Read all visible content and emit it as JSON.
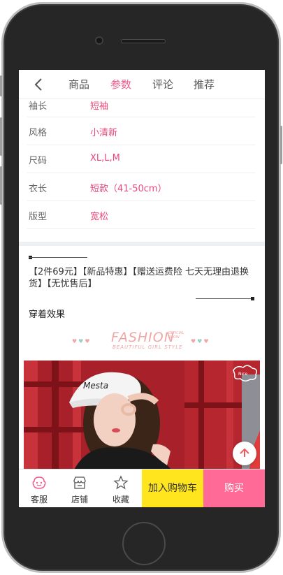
{
  "header": {
    "tabs": [
      {
        "label": "商品"
      },
      {
        "label": "参数"
      },
      {
        "label": "评论"
      },
      {
        "label": "推荐"
      }
    ],
    "active_tab": "参数"
  },
  "specs": [
    {
      "key": "袖长",
      "value": "短袖"
    },
    {
      "key": "风格",
      "value": "小清新"
    },
    {
      "key": "尺码",
      "value": "XL,L,M"
    },
    {
      "key": "衣长",
      "value": "短款（41-50cm）"
    },
    {
      "key": "版型",
      "value": "宽松"
    }
  ],
  "promo_text": "【2件69元】【新品特惠】【赠送运费险 七天无理由退换货】【无忧售后】",
  "wear_title": "穿着效果",
  "banner": {
    "title": "FASHION",
    "subtitle": "BEAUTIFUL GIRL STYLE",
    "small_text": "OFFICIAL SHOW"
  },
  "bottom_bar": {
    "service_label": "客服",
    "shop_label": "店铺",
    "favorite_label": "收藏",
    "cart_label": "加入购物车",
    "buy_label": "购买"
  },
  "colors": {
    "accent": "#f05a8d",
    "spec_value": "#e8487a",
    "cart_button": "#ffe51e",
    "buy_button": "#ff6b96"
  },
  "icons": [
    "back-arrow-icon",
    "scroll-top-icon",
    "service-icon",
    "shop-icon",
    "star-icon"
  ]
}
